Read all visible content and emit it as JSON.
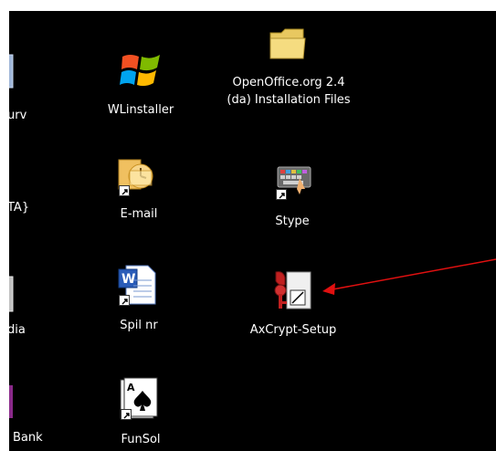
{
  "desktop": {
    "icons": [
      {
        "label": "urv"
      },
      {
        "label": "TA}"
      },
      {
        "label": "dia"
      },
      {
        "label": "Bank"
      },
      {
        "label": "WLinstaller"
      },
      {
        "label": "E-mail"
      },
      {
        "label": "Spil nr"
      },
      {
        "label": "FunSol"
      },
      {
        "label_line1": "OpenOffice.org 2.4",
        "label_line2": "(da) Installation Files"
      },
      {
        "label": "Stype"
      },
      {
        "label": "AxCrypt-Setup"
      }
    ]
  },
  "annotation": {
    "arrow_color": "#e01010"
  },
  "colors": {
    "desktop_bg": "#000000",
    "frame_bg": "#ffffff",
    "label": "#ffffff"
  }
}
